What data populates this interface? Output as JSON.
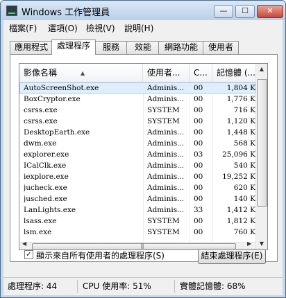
{
  "window": {
    "title": "Windows 工作管理員"
  },
  "title_controls": {
    "minimize": "—",
    "maximize": "☐",
    "close": "✕"
  },
  "menu": [
    "檔案(F)",
    "選項(O)",
    "檢視(V)",
    "說明(H)"
  ],
  "tabs": [
    {
      "label": "應用程式",
      "active": false
    },
    {
      "label": "處理程序",
      "active": true
    },
    {
      "label": "服務",
      "active": false
    },
    {
      "label": "效能",
      "active": false
    },
    {
      "label": "網路功能",
      "active": false
    },
    {
      "label": "使用者",
      "active": false
    }
  ],
  "table": {
    "columns": [
      "影像名稱",
      "使用者...",
      "C...",
      "記憶體 (..."
    ],
    "rows": [
      {
        "name": "AutoScreenShot.exe",
        "user": "Adminis...",
        "cpu": "00",
        "mem": "1,804 K",
        "selected": true
      },
      {
        "name": "BoxCryptor.exe",
        "user": "Adminis...",
        "cpu": "00",
        "mem": "1,776 K"
      },
      {
        "name": "csrss.exe",
        "user": "SYSTEM",
        "cpu": "00",
        "mem": "716 K"
      },
      {
        "name": "csrss.exe",
        "user": "SYSTEM",
        "cpu": "00",
        "mem": "1,120 K"
      },
      {
        "name": "DesktopEarth.exe",
        "user": "Adminis...",
        "cpu": "00",
        "mem": "1,448 K"
      },
      {
        "name": "dwm.exe",
        "user": "Adminis...",
        "cpu": "00",
        "mem": "568 K"
      },
      {
        "name": "explorer.exe",
        "user": "Adminis...",
        "cpu": "03",
        "mem": "25,096 K"
      },
      {
        "name": "ICalClk.exe",
        "user": "Adminis...",
        "cpu": "00",
        "mem": "540 K"
      },
      {
        "name": "iexplore.exe",
        "user": "Adminis...",
        "cpu": "00",
        "mem": "19,252 K"
      },
      {
        "name": "jucheck.exe",
        "user": "Adminis...",
        "cpu": "00",
        "mem": "620 K"
      },
      {
        "name": "jusched.exe",
        "user": "Adminis...",
        "cpu": "00",
        "mem": "140 K"
      },
      {
        "name": "LanLights.exe",
        "user": "Adminis...",
        "cpu": "33",
        "mem": "1,412 K"
      },
      {
        "name": "lsass.exe",
        "user": "SYSTEM",
        "cpu": "00",
        "mem": "1,812 K"
      },
      {
        "name": "lsm.exe",
        "user": "SYSTEM",
        "cpu": "00",
        "mem": "760 K"
      }
    ]
  },
  "show_all_users": {
    "label": "顯示來自所有使用者的處理程序(S)",
    "checked": true
  },
  "end_process_button": "結束處理程序(E)",
  "status": {
    "processes": "處理程序: 44",
    "cpu": "CPU 使用率: 51%",
    "memory": "實體記憶體: 68%"
  }
}
